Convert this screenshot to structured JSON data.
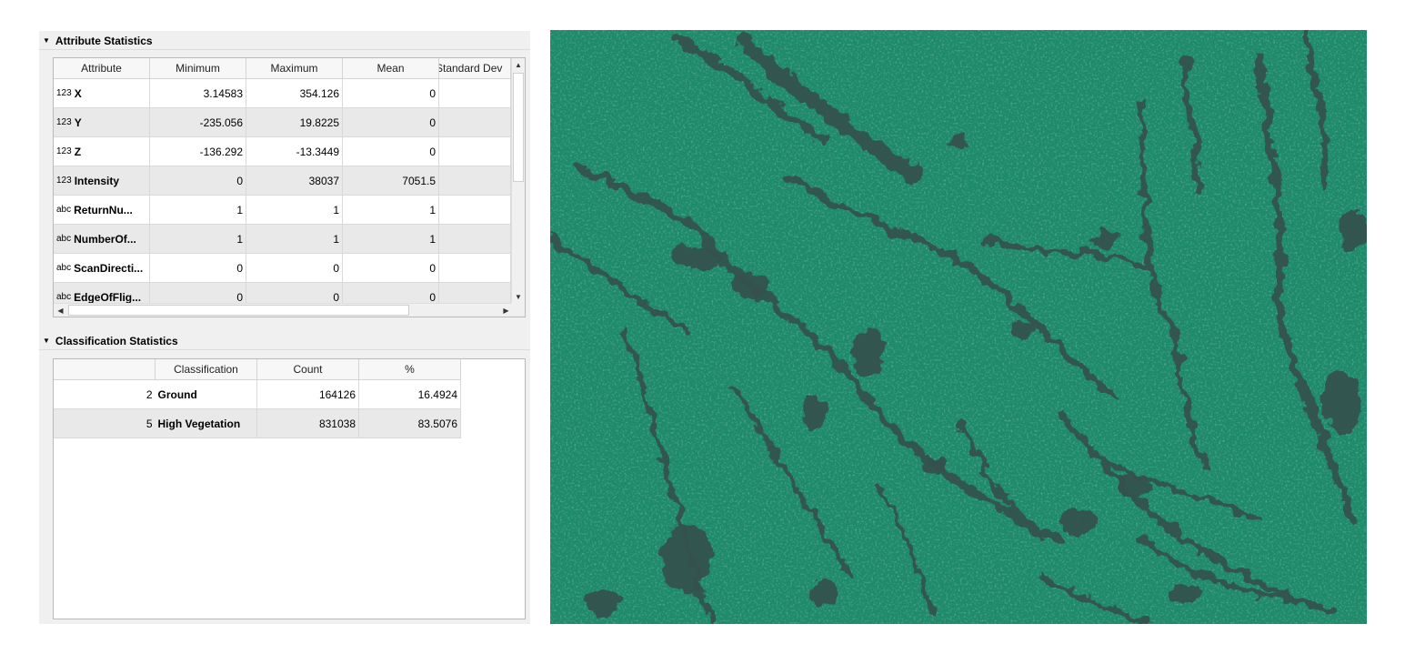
{
  "attribute_statistics": {
    "title": "Attribute Statistics",
    "columns": [
      "Attribute",
      "Minimum",
      "Maximum",
      "Mean",
      "Standard Dev"
    ],
    "rows": [
      {
        "type": "123",
        "name": "X",
        "min": "3.14583",
        "max": "354.126",
        "mean": "0"
      },
      {
        "type": "123",
        "name": "Y",
        "min": "-235.056",
        "max": "19.8225",
        "mean": "0"
      },
      {
        "type": "123",
        "name": "Z",
        "min": "-136.292",
        "max": "-13.3449",
        "mean": "0"
      },
      {
        "type": "123",
        "name": "Intensity",
        "min": "0",
        "max": "38037",
        "mean": "7051.5"
      },
      {
        "type": "abc",
        "name": "ReturnNu...",
        "min": "1",
        "max": "1",
        "mean": "1"
      },
      {
        "type": "abc",
        "name": "NumberOf...",
        "min": "1",
        "max": "1",
        "mean": "1"
      },
      {
        "type": "abc",
        "name": "ScanDirecti...",
        "min": "0",
        "max": "0",
        "mean": "0"
      },
      {
        "type": "abc",
        "name": "EdgeOfFlig...",
        "min": "0",
        "max": "0",
        "mean": "0"
      }
    ]
  },
  "classification_statistics": {
    "title": "Classification Statistics",
    "columns": [
      "",
      "Classification",
      "Count",
      "%"
    ],
    "rows": [
      {
        "code": "2",
        "classification": "Ground",
        "count": "164126",
        "percent": "16.4924"
      },
      {
        "code": "5",
        "classification": "High Vegetation",
        "count": "831038",
        "percent": "83.5076"
      }
    ]
  },
  "icons": {
    "expand": "triangle-down-icon",
    "scroll_up": "arrow-up-icon",
    "scroll_down": "arrow-down-icon",
    "scroll_left": "arrow-left-icon",
    "scroll_right": "arrow-right-icon"
  },
  "colors": {
    "canopy": "#1f8a6a",
    "gaps": "#34514d",
    "row_alt": "#e9e9e9"
  }
}
